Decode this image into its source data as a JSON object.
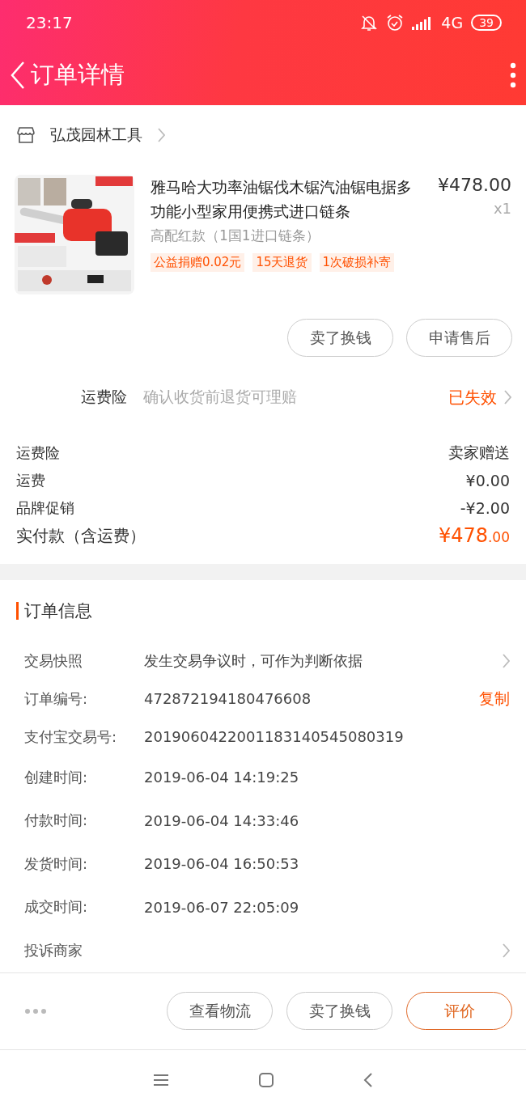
{
  "status_bar": {
    "time": "23:17",
    "network": "4G",
    "battery": "39"
  },
  "header": {
    "title": "订单详情"
  },
  "shop": {
    "name": "弘茂园林工具"
  },
  "product": {
    "kind": "picture",
    "title": "雅马哈大功率油锯伐木锯汽油锯电据多功能小型家用便携式进口链条",
    "price": "¥478.00",
    "quantity": "x1",
    "variant": "高配红款（1国1进口链条）",
    "tags": [
      "公益捐赠0.02元",
      "15天退货",
      "1次破损补寄"
    ]
  },
  "product_buttons": [
    "卖了换钱",
    "申请售后"
  ],
  "insurance": {
    "label": "运费险",
    "description": "确认收货前退货可理赔",
    "status": "已失效"
  },
  "costs": [
    {
      "label": "运费险",
      "value": "卖家赠送"
    },
    {
      "label": "运费",
      "value": "¥0.00"
    },
    {
      "label": "品牌促销",
      "value": "-¥2.00"
    }
  ],
  "total": {
    "label": "实付款（含运费）",
    "amount": "¥478",
    "decimals": ".00"
  },
  "order_info": {
    "title": "订单信息",
    "rows": [
      {
        "kind": "link",
        "label": "交易快照",
        "value": "发生交易争议时，可作为判断依据"
      },
      {
        "kind": "copy",
        "label": "订单编号:",
        "value": "472872194180476608",
        "action": "复制"
      },
      {
        "kind": "plain",
        "label": "支付宝交易号:",
        "value": "2019060422001183140545080319"
      },
      {
        "kind": "plain",
        "label": "创建时间:",
        "value": "2019-06-04 14:19:25"
      },
      {
        "kind": "plain",
        "label": "付款时间:",
        "value": "2019-06-04 14:33:46"
      },
      {
        "kind": "plain",
        "label": "发货时间:",
        "value": "2019-06-04 16:50:53"
      },
      {
        "kind": "plain",
        "label": "成交时间:",
        "value": "2019-06-07 22:05:09"
      },
      {
        "kind": "link",
        "label": "投诉商家"
      }
    ]
  },
  "footer_buttons": [
    {
      "label": "查看物流",
      "highlighted": false
    },
    {
      "label": "卖了换钱",
      "highlighted": false
    },
    {
      "label": "评价",
      "highlighted": true
    }
  ]
}
